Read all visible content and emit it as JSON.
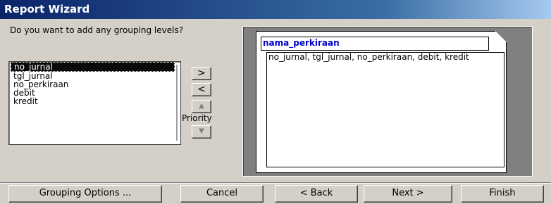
{
  "window": {
    "title": "Report Wizard"
  },
  "question": "Do you want to add any grouping levels?",
  "fields": [
    {
      "label": "no_jurnal",
      "selected": true
    },
    {
      "label": "tgl_jurnal",
      "selected": false
    },
    {
      "label": "no_perkiraan",
      "selected": false
    },
    {
      "label": "debit",
      "selected": false
    },
    {
      "label": "kredit",
      "selected": false
    }
  ],
  "buttons": {
    "add": ">",
    "remove": "<",
    "priority_up": "▲",
    "priority_label": "Priority",
    "priority_down": "▼",
    "grouping_options": "Grouping Options ...",
    "cancel": "Cancel",
    "back": "< Back",
    "next": "Next >",
    "finish": "Finish"
  },
  "preview": {
    "group_field": "nama_perkiraan",
    "detail_fields": "no_jurnal, tgl_jurnal, no_perkiraan, debit, kredit"
  }
}
